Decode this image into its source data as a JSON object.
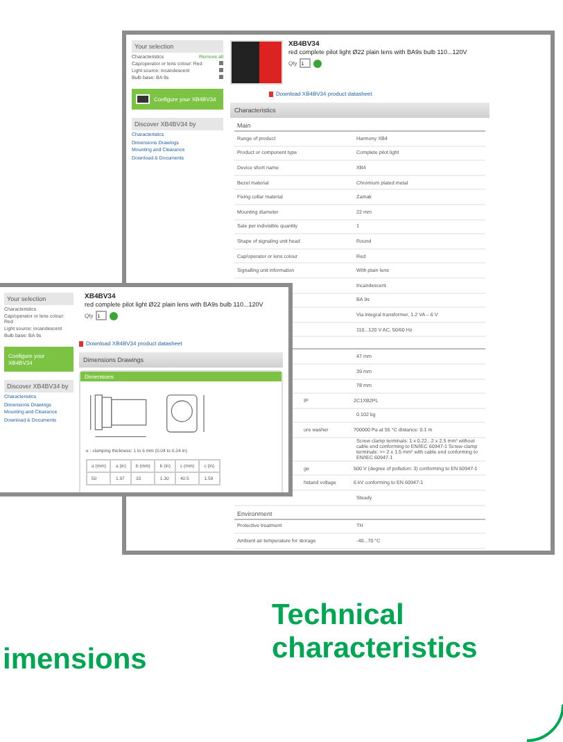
{
  "main_page": {
    "selection": {
      "title": "Your selection",
      "heading": "Characteristics",
      "remove": "Remove all",
      "filters": [
        "Cap/operator or lens colour: Red",
        "Light source: incandescent",
        "Bulb base: BA 9s"
      ]
    },
    "configure": "Configure your XB4BV34",
    "discover": {
      "title": "Discover XB4BV34 by",
      "links": [
        "Characteristics",
        "Dimensions Drawings",
        "Mounting and Clearance",
        "Download & Documents"
      ]
    },
    "product": {
      "ref": "XB4BV34",
      "title": "red complete pilot light Ø22 plain lens with BA9s bulb 110...120V",
      "qty_label": "Qty",
      "qty": "1",
      "download": "Download XB4BV34 product datasheet"
    },
    "section": "Characteristics",
    "groups": [
      {
        "title": "Main",
        "rows": [
          {
            "kind": "full",
            "label": "Range of product",
            "value": "Harmony XB4"
          },
          {
            "kind": "full",
            "label": "Product or component type",
            "value": "Complete pilot light"
          },
          {
            "kind": "full",
            "label": "Device short name",
            "value": "XB4"
          },
          {
            "kind": "full",
            "label": "Bezel material",
            "value": "Chromium plated metal"
          },
          {
            "kind": "full",
            "label": "Fixing collar material",
            "value": "Zamak"
          },
          {
            "kind": "full",
            "label": "Mounting diameter",
            "value": "22 mm"
          },
          {
            "kind": "full",
            "label": "Sale per indivisible quantity",
            "value": "1"
          },
          {
            "kind": "full",
            "label": "Shape of signaling unit head",
            "value": "Round"
          },
          {
            "kind": "full",
            "label": "Cap/operator or lens colour",
            "value": "Red"
          },
          {
            "kind": "full",
            "label": "Signalling unit information",
            "value": "With plain lens"
          },
          {
            "kind": "hidden",
            "value": "Incandescent"
          },
          {
            "kind": "hidden",
            "value": "BA 9s"
          },
          {
            "kind": "hidden",
            "value": "Via integral transformer, 1.2 VA – 6 V"
          },
          {
            "kind": "hidden",
            "value": "110...120 V AC, 50/60 Hz"
          }
        ]
      },
      {
        "rows": [
          {
            "kind": "hidden",
            "value": "47 mm"
          },
          {
            "kind": "hidden",
            "value": "39 mm"
          },
          {
            "kind": "hidden",
            "value": "78 mm"
          },
          {
            "kind": "partial",
            "label": "IP",
            "value": "2C1XB2PL"
          },
          {
            "kind": "hidden",
            "value": "0.102 kg"
          },
          {
            "kind": "partial",
            "label": "ure washer",
            "value": "700000 Pa at 55 °C distance: 0.1 m"
          },
          {
            "kind": "hidden",
            "value": "Screw clamp terminals: 1 x 0.22...2 x 2.5 mm² without cable end conforming to EN/IEC 60947-1 Screw clamp terminals: >= 2 x 1.5 mm² with cable end conforming to EN/IEC 60947-1"
          },
          {
            "kind": "partial",
            "label": "ge",
            "value": "500 V (degree of pollution: 3) conforming to EN 60947-1"
          },
          {
            "kind": "partial",
            "label": "hstand voltage",
            "value": "6 kV conforming to EN 60947-1"
          },
          {
            "kind": "hidden",
            "value": "Steady"
          }
        ]
      },
      {
        "title": "Environment",
        "rows": [
          {
            "kind": "full",
            "label": "Protective treatment",
            "value": "TH"
          },
          {
            "kind": "full",
            "label": "Ambient air temperature for storage",
            "value": "-40...70 °C"
          }
        ]
      }
    ]
  },
  "dimensions_page": {
    "selection": {
      "title": "Your selection",
      "filters": [
        "Characteristics",
        "Cap/operator or lens colour: Red",
        "Light source: incandescent",
        "Bulb base: BA 9s"
      ]
    },
    "configure": "Configure your XB4BV34",
    "discover": {
      "title": "Discover XB4BV34 by",
      "links": [
        "Characteristics",
        "Dimensions Drawings",
        "Mounting and Clearance",
        "Download & Documents"
      ]
    },
    "product": {
      "ref": "XB4BV34",
      "title": "red complete pilot light Ø22 plain lens with BA9s bulb 110...120V",
      "qty_label": "Qty",
      "qty": "1",
      "download": "Download XB4BV34 product datasheet"
    },
    "section": "Dimensions Drawings",
    "subsection": "Dimensions",
    "caption": "e : clamping thickness: 1 to 6 mm (0.04 to 0.24 in)",
    "table": {
      "columns": [
        "a (mm)",
        "a (in)",
        "b (mm)",
        "b (in)",
        "c (mm)",
        "c (in)"
      ],
      "values": [
        "50",
        "1.97",
        "33",
        "1.30",
        "40.5",
        "1.59"
      ]
    }
  },
  "captions": [
    "imensions",
    "Technical characteristics"
  ]
}
